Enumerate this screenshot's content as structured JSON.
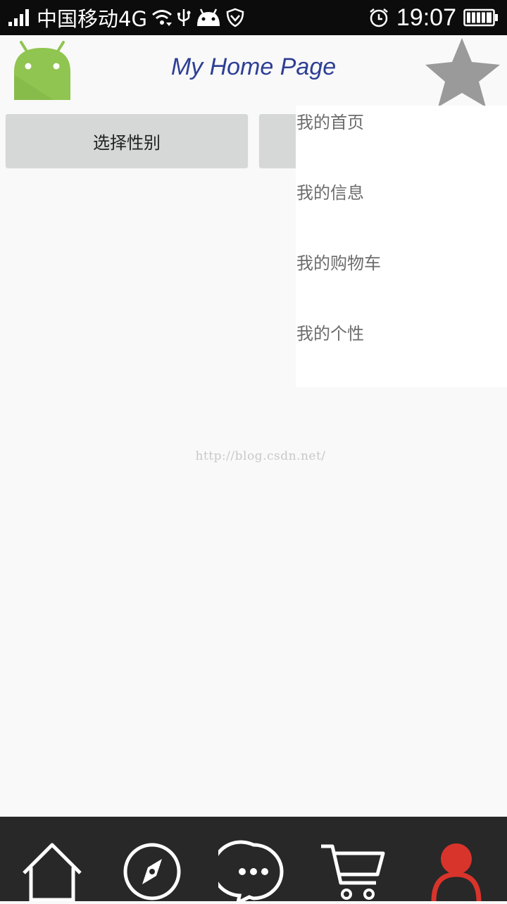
{
  "status_bar": {
    "carrier": "中国移动4G",
    "time": "19:07",
    "icons": [
      "signal-icon",
      "wifi-icon",
      "usb-icon",
      "android-debug-icon",
      "shield-icon",
      "alarm-icon",
      "battery-icon"
    ]
  },
  "action_bar": {
    "title": "My Home Page",
    "logo_icon": "android-logo-icon",
    "menu_icon": "star-icon"
  },
  "buttons": {
    "gender_label": "选择性别"
  },
  "dropdown_menu": {
    "items": [
      "我的首页",
      "我的信息",
      "我的购物车",
      "我的个性"
    ]
  },
  "watermark": "http://blog.csdn.net/",
  "bottom_nav": {
    "items": [
      "home-icon",
      "compass-icon",
      "chat-icon",
      "cart-icon",
      "profile-icon"
    ],
    "active_color": "#d9342b"
  },
  "colors": {
    "title": "#2e3f94",
    "android_green": "#8fc550",
    "star_gray": "#9a9a9a",
    "nav_bg": "#282828"
  }
}
